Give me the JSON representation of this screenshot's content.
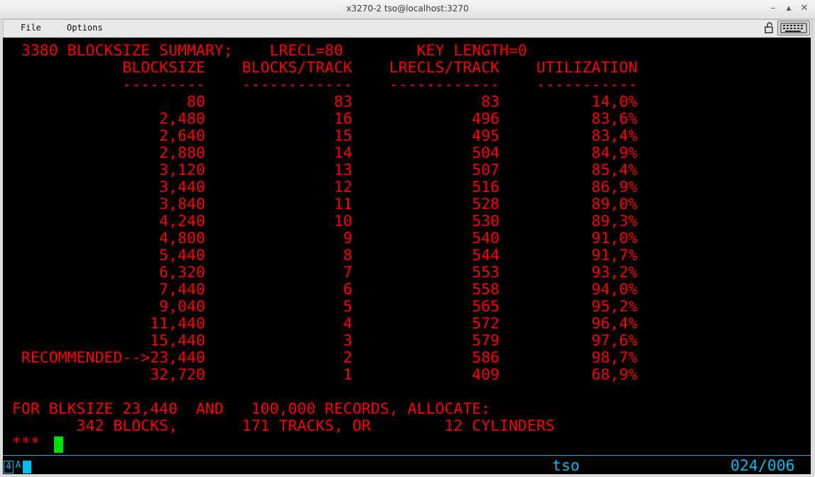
{
  "window": {
    "title": "x3270-2 tso@localhost:3270"
  },
  "menu": {
    "file": "File",
    "options": "Options"
  },
  "terminal": {
    "lines": [
      "  3380 BLOCKSIZE SUMMARY;    LRECL=80        KEY LENGTH=0",
      "             BLOCKSIZE    BLOCKS/TRACK    LRECLS/TRACK    UTILIZATION",
      "             ---------    ------------    ------------    -----------",
      "                    80              83              83          14,0%",
      "                 2,480              16             496          83,6%",
      "                 2,640              15             495          83,4%",
      "                 2,880              14             504          84,9%",
      "                 3,120              13             507          85,4%",
      "                 3,440              12             516          86,9%",
      "                 3,840              11             528          89,0%",
      "                 4,240              10             530          89,3%",
      "                 4,800               9             540          91,0%",
      "                 5,440               8             544          91,7%",
      "                 6,320               7             553          93,2%",
      "                 7,440               6             558          94,0%",
      "                 9,040               5             565          95,2%",
      "                11,440               4             572          96,4%",
      "                15,440               3             579          97,6%",
      "  RECOMMENDED-->23,440               2             586          98,7%",
      "                32,720               1             409          68,9%",
      "",
      " FOR BLKSIZE 23,440  AND   100,000 RECORDS, ALLOCATE:",
      "        342 BLOCKS,       171 TRACKS, OR        12 CYLINDERS",
      " ***"
    ]
  },
  "oia": {
    "box_symbol": "4",
    "a_symbol": "A",
    "session": "tso",
    "cursor_pos": "024/006"
  },
  "colors": {
    "screen_bg": "#000000",
    "text": "#ff0000",
    "cursor": "#00e000",
    "status": "#00bff0"
  }
}
